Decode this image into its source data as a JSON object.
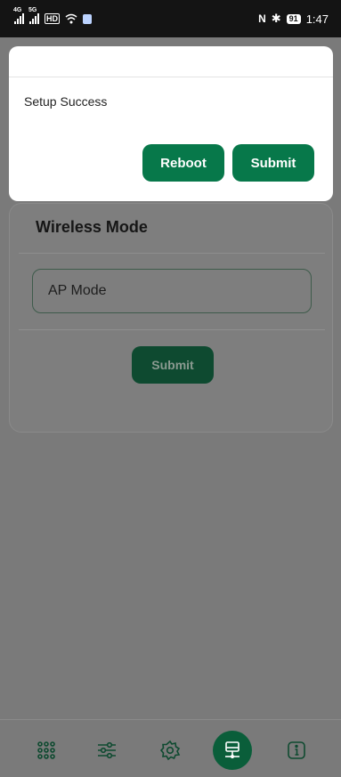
{
  "status_bar": {
    "network_tag_1": "4G",
    "network_tag_2": "5G",
    "hd_badge": "HD",
    "battery": "91",
    "time": "1:47",
    "nfc_glyph": "N",
    "icons": [
      "signal-4g-icon",
      "signal-5g-icon",
      "hd-icon",
      "wifi-icon",
      "app-notification-icon",
      "nfc-icon",
      "bluetooth-icon",
      "battery-icon"
    ]
  },
  "dialog": {
    "message": "Setup Success",
    "reboot_label": "Reboot",
    "submit_label": "Submit"
  },
  "card": {
    "title": "Wireless Mode",
    "mode_value": "AP Mode",
    "submit_label": "Submit"
  },
  "bottom_nav": {
    "items": [
      {
        "icon": "grid-icon",
        "active": false
      },
      {
        "icon": "sliders-icon",
        "active": false
      },
      {
        "icon": "gear-icon",
        "active": false
      },
      {
        "icon": "network-icon",
        "active": true
      },
      {
        "icon": "info-icon",
        "active": false
      }
    ]
  },
  "colors": {
    "primary_green": "#07784a",
    "active_nav": "#0a5e3a",
    "overlay_gray": "#7a7a7a",
    "statusbar": "#141414"
  }
}
